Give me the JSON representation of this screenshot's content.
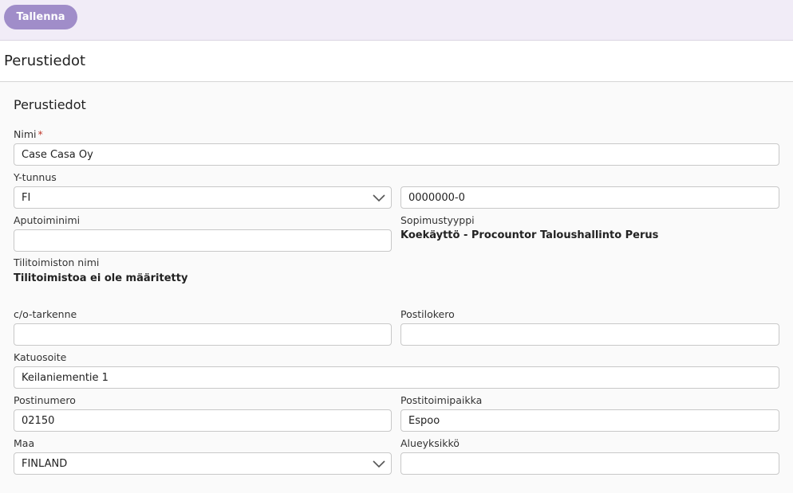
{
  "toolbar": {
    "save_label": "Tallenna"
  },
  "page": {
    "title": "Perustiedot"
  },
  "section": {
    "title": "Perustiedot"
  },
  "fields": {
    "nimi": {
      "label": "Nimi",
      "required_mark": "*",
      "value": "Case Casa Oy"
    },
    "ytunnus": {
      "label": "Y-tunnus",
      "country_value": "FI",
      "value": "0000000-0"
    },
    "aputoiminimi": {
      "label": "Aputoiminimi",
      "value": ""
    },
    "sopimustyyppi": {
      "label": "Sopimustyyppi",
      "value": "Koekäyttö - Procountor Taloushallinto Perus"
    },
    "tilitoimisto": {
      "label": "Tilitoimiston nimi",
      "value": "Tilitoimistoa ei ole määritetty"
    },
    "co_tarkenne": {
      "label": "c/o-tarkenne",
      "value": ""
    },
    "postilokero": {
      "label": "Postilokero",
      "value": ""
    },
    "katuosoite": {
      "label": "Katuosoite",
      "value": "Keilaniementie 1"
    },
    "postinumero": {
      "label": "Postinumero",
      "value": "02150"
    },
    "postitoimipaikka": {
      "label": "Postitoimipaikka",
      "value": "Espoo"
    },
    "maa": {
      "label": "Maa",
      "value": "FINLAND"
    },
    "alueyksikko": {
      "label": "Alueyksikkö",
      "value": ""
    }
  },
  "icons": {
    "dropdown": "chevron-down-icon"
  },
  "colors": {
    "accent": "#a08dc9",
    "toolbar_bg": "#f1ecf7",
    "required": "#c0392b"
  }
}
